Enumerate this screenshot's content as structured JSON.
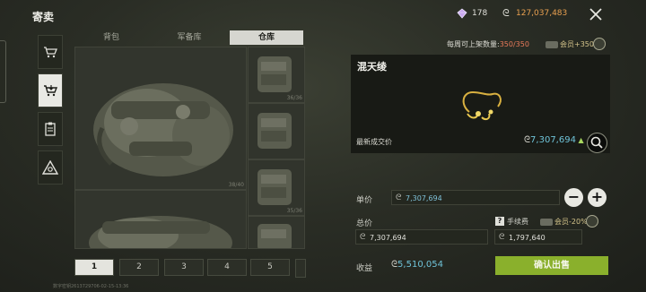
{
  "header": {
    "title": "寄卖",
    "gems": "178",
    "coins": "127,037,483",
    "accent_coins": "#e8a050"
  },
  "nav": {
    "items": [
      "cart-icon",
      "cart-arrow-icon",
      "clipboard-icon",
      "triangle-eye-icon"
    ],
    "active_index": 1
  },
  "tabs": [
    {
      "label": "背包"
    },
    {
      "label": "军备库"
    },
    {
      "label": "仓库"
    }
  ],
  "grid": {
    "big_caption": "38/40",
    "small_captions": [
      "36/36",
      "",
      "35/36",
      ""
    ]
  },
  "pager": {
    "pages": [
      "1",
      "2",
      "3",
      "4",
      "5"
    ],
    "active_index": 0
  },
  "footer": {
    "text": "数字密钥2613729706-02-15-13:36"
  },
  "listing": {
    "weekly_label": "每周可上架数量:",
    "weekly_value": "350/350",
    "member_bonus": "会员+350",
    "item_name": "混天绫",
    "latest_label": "最新成交价",
    "latest_value": "7,307,694",
    "unit_price_label": "单价",
    "unit_price_value": "7,307,694",
    "total_label": "总价",
    "total_value": "7,307,694",
    "fee_label": "手续费",
    "fee_member": "会员-20%",
    "fee_value": "1,797,640",
    "income_label": "收益",
    "income_value": "5,510,054",
    "confirm_label": "确认出售",
    "accent_confirm": "#8ab02c",
    "accent_price": "#6fc3d8"
  }
}
